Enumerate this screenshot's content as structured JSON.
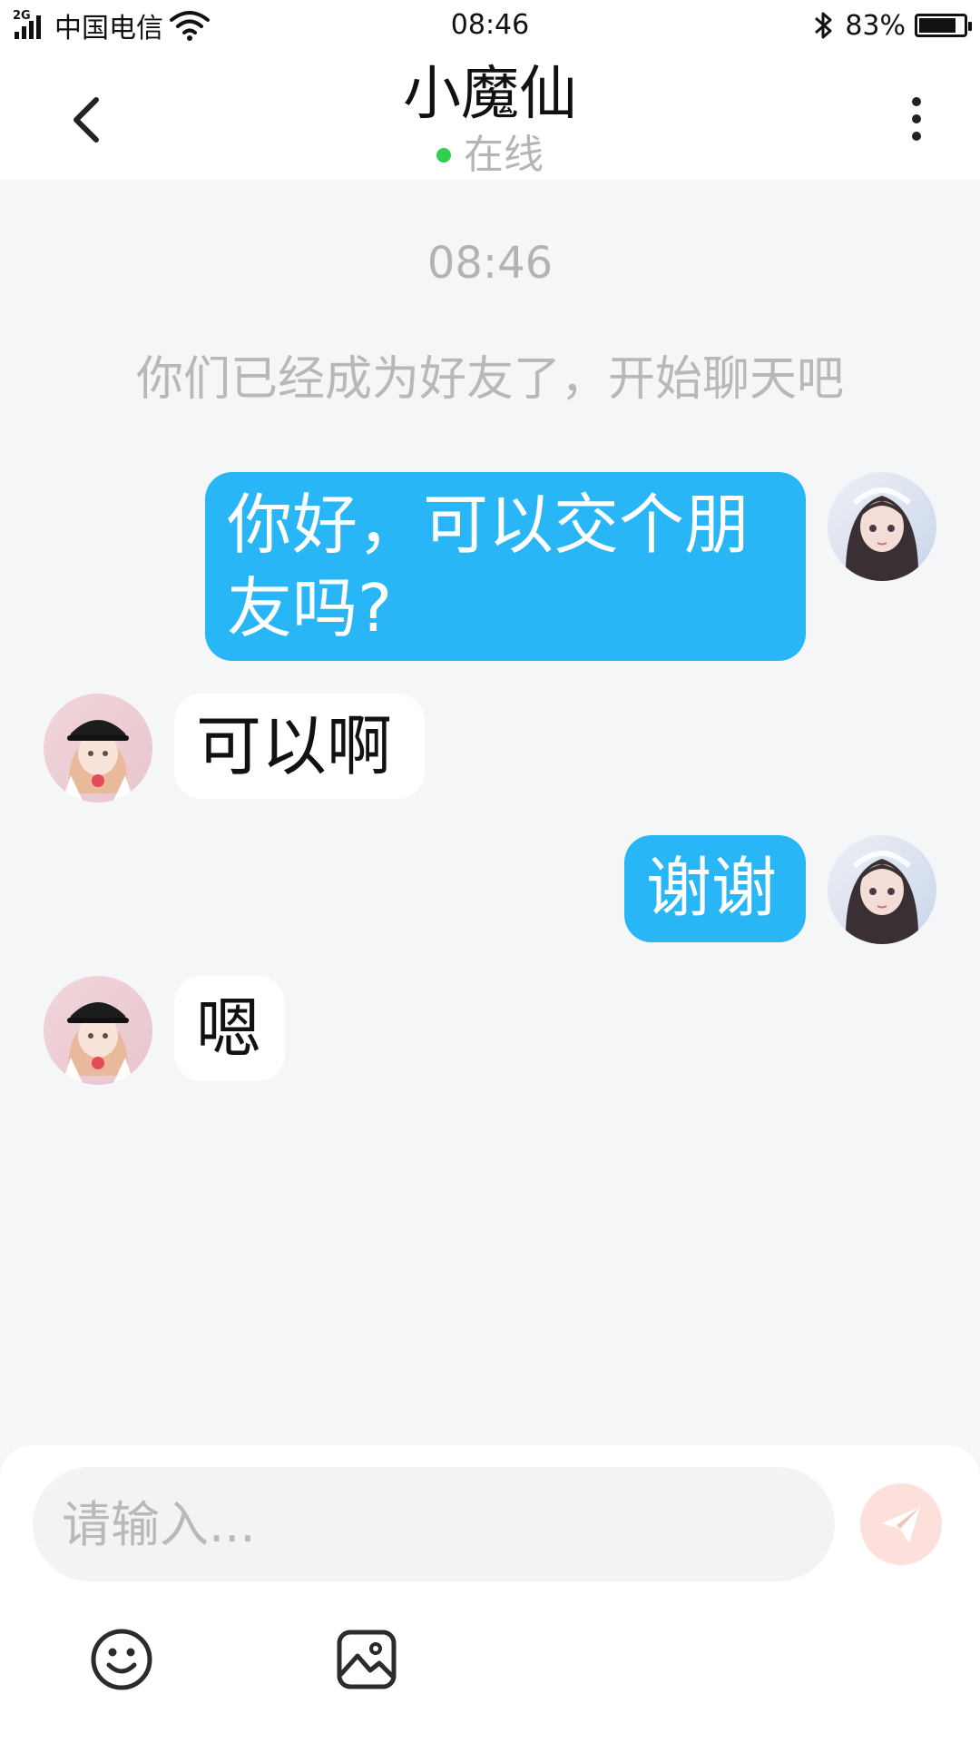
{
  "status_bar": {
    "network": "2G",
    "carrier": "中国电信",
    "time": "08:46",
    "battery": "83%",
    "battery_level": 0.83
  },
  "header": {
    "title": "小魔仙",
    "status": "在线"
  },
  "chat": {
    "timestamp": "08:46",
    "system_message": "你们已经成为好友了，开始聊天吧",
    "messages": [
      {
        "sender": "me",
        "text": "你好，可以交个朋友吗?"
      },
      {
        "sender": "them",
        "text": "可以啊"
      },
      {
        "sender": "me",
        "text": "谢谢"
      },
      {
        "sender": "them",
        "text": "嗯"
      }
    ]
  },
  "input": {
    "placeholder": "请输入..."
  },
  "colors": {
    "accent": "#29b6f6",
    "online": "#2fcf4f",
    "send_button": "#fde0dc",
    "background": "#f5f6f8"
  },
  "icons": {
    "back": "chevron-left-icon",
    "more": "more-vertical-icon",
    "send": "paper-plane-icon",
    "emoji": "smiley-icon",
    "image": "image-icon"
  }
}
